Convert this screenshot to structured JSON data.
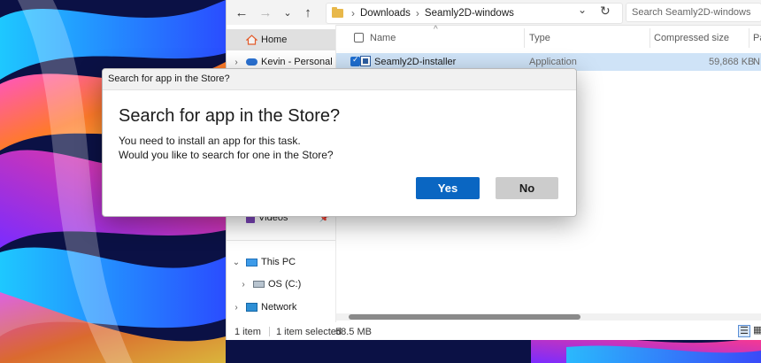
{
  "colors": {
    "accent": "#0a66c2",
    "selection": "#cfe3f7",
    "no_button": "#cccccc"
  },
  "explorer": {
    "breadcrumb": [
      "Downloads",
      "Seamly2D-windows"
    ],
    "search_placeholder": "Search Seamly2D-windows",
    "sidebar": [
      {
        "label": "Home",
        "icon": "home-icon"
      },
      {
        "label": "Kevin - Personal",
        "icon": "cloud-icon"
      },
      {
        "label": "Videos",
        "icon": "videos-icon"
      },
      {
        "label": "This PC",
        "icon": "this-pc-icon"
      },
      {
        "label": "OS (C:)",
        "icon": "drive-icon"
      },
      {
        "label": "Network",
        "icon": "network-icon"
      }
    ],
    "columns": [
      "Name",
      "Type",
      "Compressed size",
      "Pa"
    ],
    "files": [
      {
        "name": "Seamly2D-installer",
        "type": "Application",
        "compressed_size": "59,868 KB",
        "extra": "N"
      }
    ],
    "status": {
      "count": "1 item",
      "selected": "1 item selected",
      "size": "58.5 MB"
    }
  },
  "dialog": {
    "titlebar": "Search for app in the Store?",
    "heading": "Search for app in the Store?",
    "line1": "You need to install an app for this task.",
    "line2": "Would you like to search for one in the Store?",
    "yes_label": "Yes",
    "no_label": "No"
  }
}
